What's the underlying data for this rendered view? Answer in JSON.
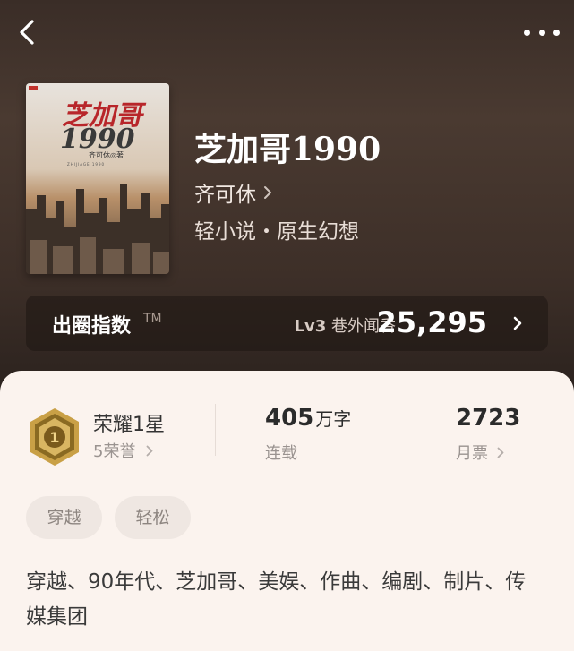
{
  "header": {
    "back_icon": "back-arrow-icon",
    "more_icon": "more-dots-icon"
  },
  "book": {
    "cover": {
      "title_art": "芝加哥",
      "year_art": "1990",
      "author_art": "齐可休◎著",
      "pinyin_art": "ZHIJIAGE 1990"
    },
    "title": "芝加哥1990",
    "author": "齐可休",
    "genre": "轻小说・原生幻想"
  },
  "index": {
    "label": "出圈指数",
    "tm": "TM",
    "level_code": "Lv3",
    "level_name": "巷外闻香",
    "score": "25,295"
  },
  "stats": {
    "honor_title": "荣耀1星",
    "honor_sub": "5荣誉",
    "badge_number": "1",
    "words_num": "405",
    "words_unit": "万字",
    "words_status": "连载",
    "tickets_num": "2723",
    "tickets_label": "月票"
  },
  "tags": [
    "穿越",
    "轻松"
  ],
  "description": "穿越、90年代、芝加哥、美娱、作曲、编剧、制片、传媒集团",
  "colors": {
    "hero_bg": "#3d2f28",
    "panel_bg": "#fbf3ee",
    "tag_bg": "#efe7e2",
    "badge_gold": "#c9a046"
  }
}
